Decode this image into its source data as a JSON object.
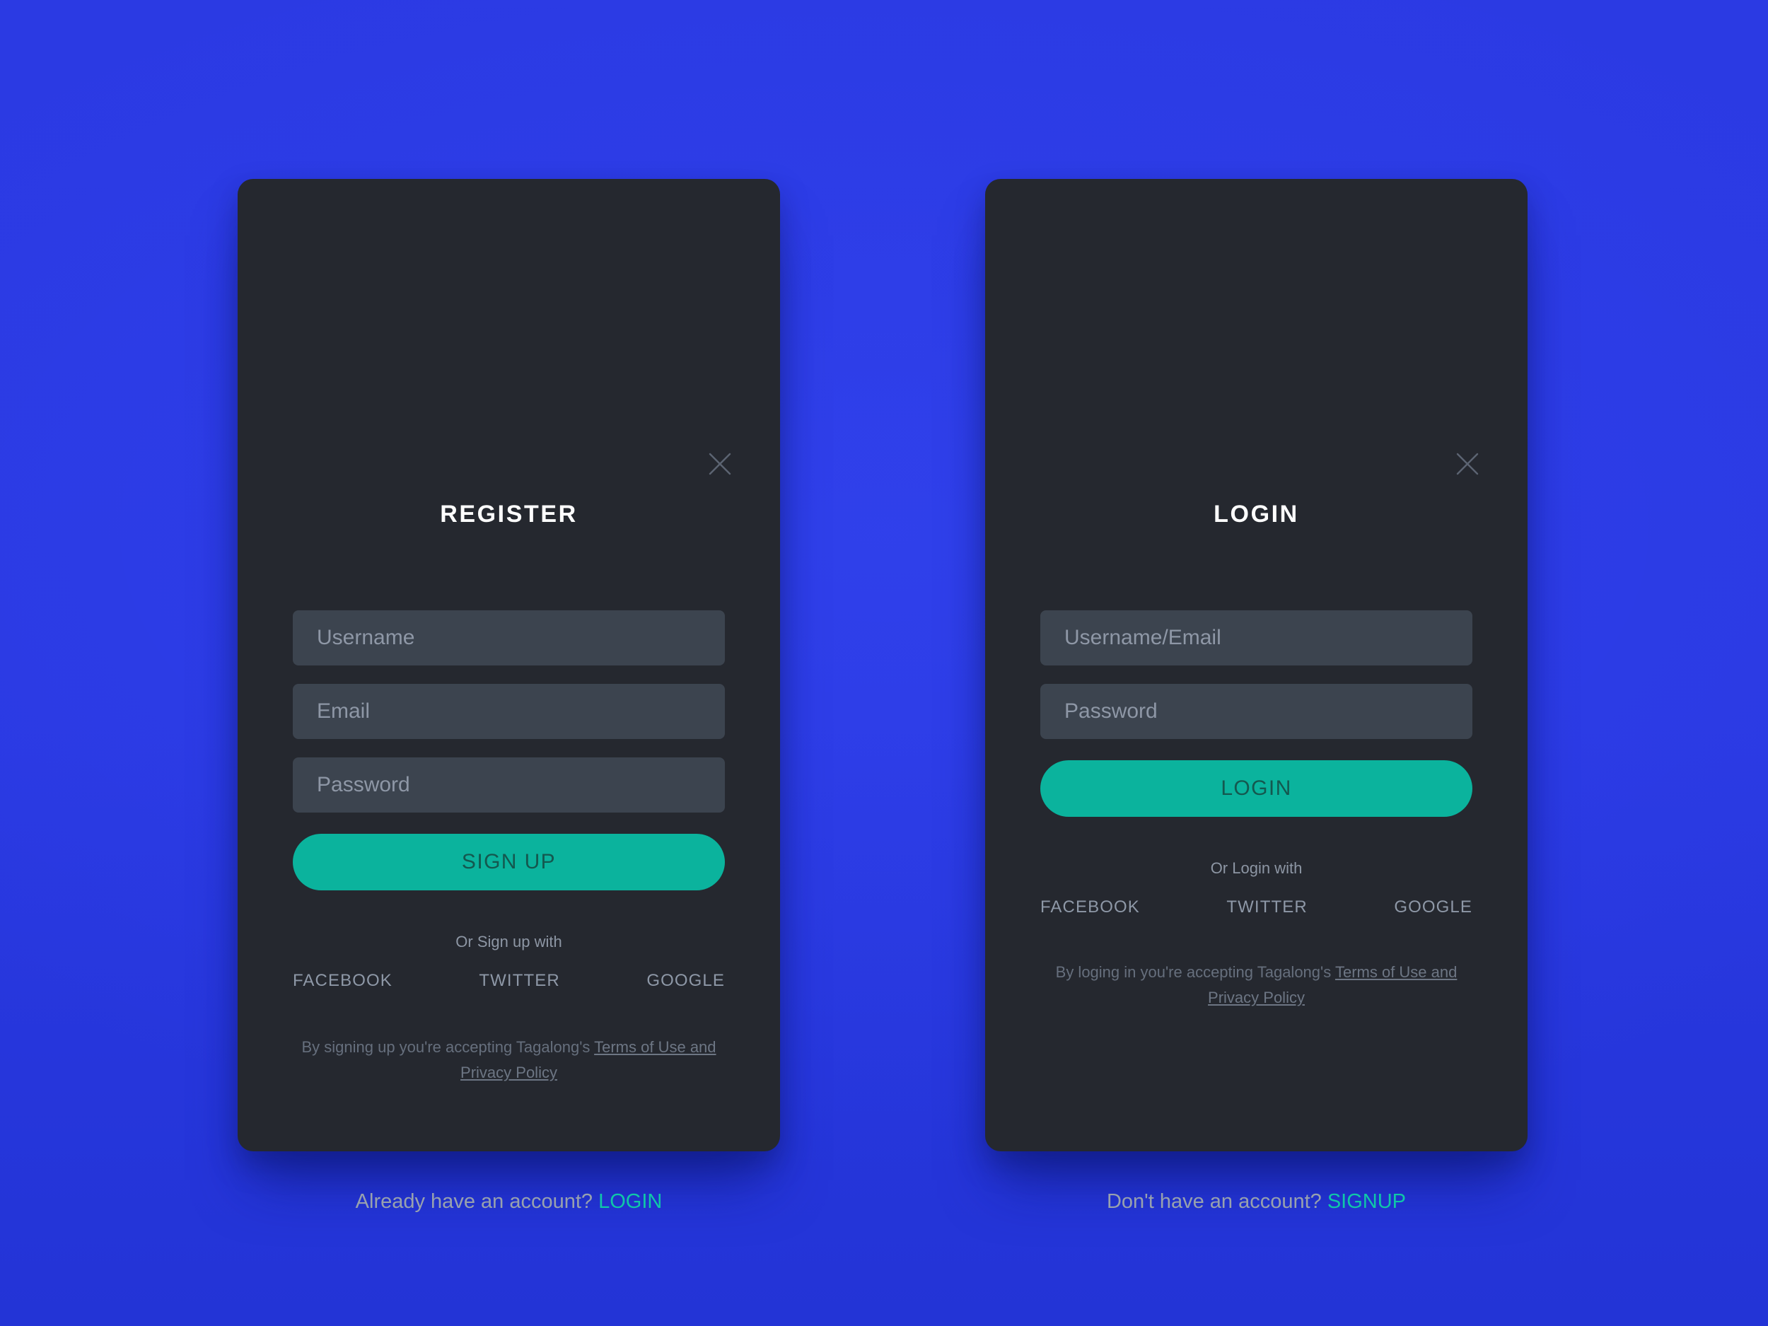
{
  "theme": {
    "background_blue": "#2a3ae0",
    "card_background": "#25282f",
    "input_background": "#3c444f",
    "accent_teal": "#0bb39d",
    "accent_link": "#0fc7a8",
    "button_text": "#14584f",
    "muted_text": "#8e98a7"
  },
  "register": {
    "title": "REGISTER",
    "close_icon": "close-icon",
    "fields": [
      {
        "name": "username",
        "placeholder": "Username",
        "value": ""
      },
      {
        "name": "email",
        "placeholder": "Email",
        "value": ""
      },
      {
        "name": "password",
        "placeholder": "Password",
        "value": ""
      }
    ],
    "submit_label": "SIGN UP",
    "or_label": "Or Sign up with",
    "social": [
      {
        "name": "facebook",
        "label": "FACEBOOK"
      },
      {
        "name": "twitter",
        "label": "TWITTER"
      },
      {
        "name": "google",
        "label": "GOOGLE"
      }
    ],
    "terms_prefix": "By signing up you're accepting Tagalong's ",
    "terms_link": "Terms of Use and Privacy Policy",
    "switch_prompt": "Already have an account? ",
    "switch_link": "LOGIN"
  },
  "login": {
    "title": "LOGIN",
    "close_icon": "close-icon",
    "fields": [
      {
        "name": "username-email",
        "placeholder": "Username/Email",
        "value": ""
      },
      {
        "name": "password",
        "placeholder": "Password",
        "value": ""
      }
    ],
    "submit_label": "LOGIN",
    "or_label": "Or Login with",
    "social": [
      {
        "name": "facebook",
        "label": "FACEBOOK"
      },
      {
        "name": "twitter",
        "label": "TWITTER"
      },
      {
        "name": "google",
        "label": "GOOGLE"
      }
    ],
    "terms_prefix": "By loging in you're accepting Tagalong's ",
    "terms_link": "Terms of Use and Privacy Policy",
    "switch_prompt": "Don't have an account? ",
    "switch_link": "SIGNUP"
  }
}
